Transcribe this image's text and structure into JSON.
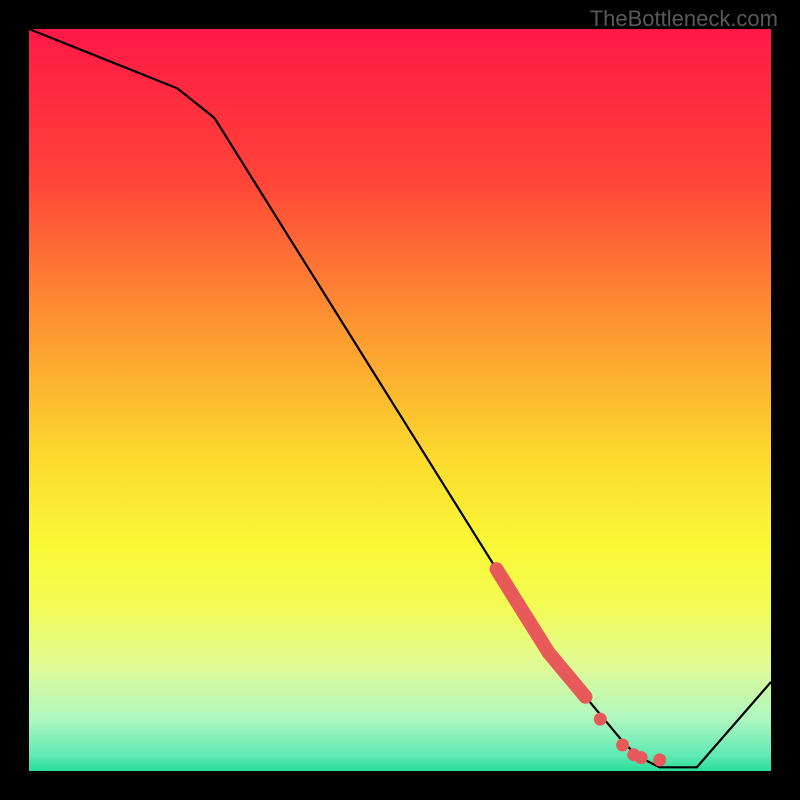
{
  "watermark": "TheBottleneck.com",
  "chart_data": {
    "type": "line",
    "title": "",
    "xlabel": "",
    "ylabel": "",
    "xlim": [
      0,
      100
    ],
    "ylim": [
      0,
      100
    ],
    "x": [
      0,
      5,
      10,
      15,
      20,
      25,
      30,
      35,
      40,
      45,
      50,
      55,
      60,
      65,
      70,
      75,
      80,
      82,
      85,
      90,
      100
    ],
    "values": [
      100,
      98,
      96,
      94,
      92,
      88,
      80,
      72,
      64,
      56,
      48,
      40,
      32,
      24,
      16,
      10,
      4,
      2,
      0.5,
      0.5,
      12
    ],
    "highlight_segment": {
      "x_start": 63,
      "x_end": 75,
      "description": "thick coral segment on descending line"
    },
    "highlight_points": [
      {
        "x": 77,
        "y": 7
      },
      {
        "x": 80,
        "y": 3.5
      },
      {
        "x": 81.5,
        "y": 2.2
      },
      {
        "x": 82.5,
        "y": 1.8
      },
      {
        "x": 85,
        "y": 1.5
      }
    ],
    "background": {
      "type": "vertical_gradient",
      "stops": [
        {
          "pos": 0.0,
          "color": "#ff1846"
        },
        {
          "pos": 0.2,
          "color": "#ff4338"
        },
        {
          "pos": 0.4,
          "color": "#fd9631"
        },
        {
          "pos": 0.58,
          "color": "#fcdb2e"
        },
        {
          "pos": 0.7,
          "color": "#f9f937"
        },
        {
          "pos": 0.78,
          "color": "#f3fb55"
        },
        {
          "pos": 0.86,
          "color": "#dffb97"
        },
        {
          "pos": 0.93,
          "color": "#aef7c0"
        },
        {
          "pos": 0.98,
          "color": "#5ee9b3"
        },
        {
          "pos": 1.0,
          "color": "#27dd9a"
        }
      ]
    }
  }
}
